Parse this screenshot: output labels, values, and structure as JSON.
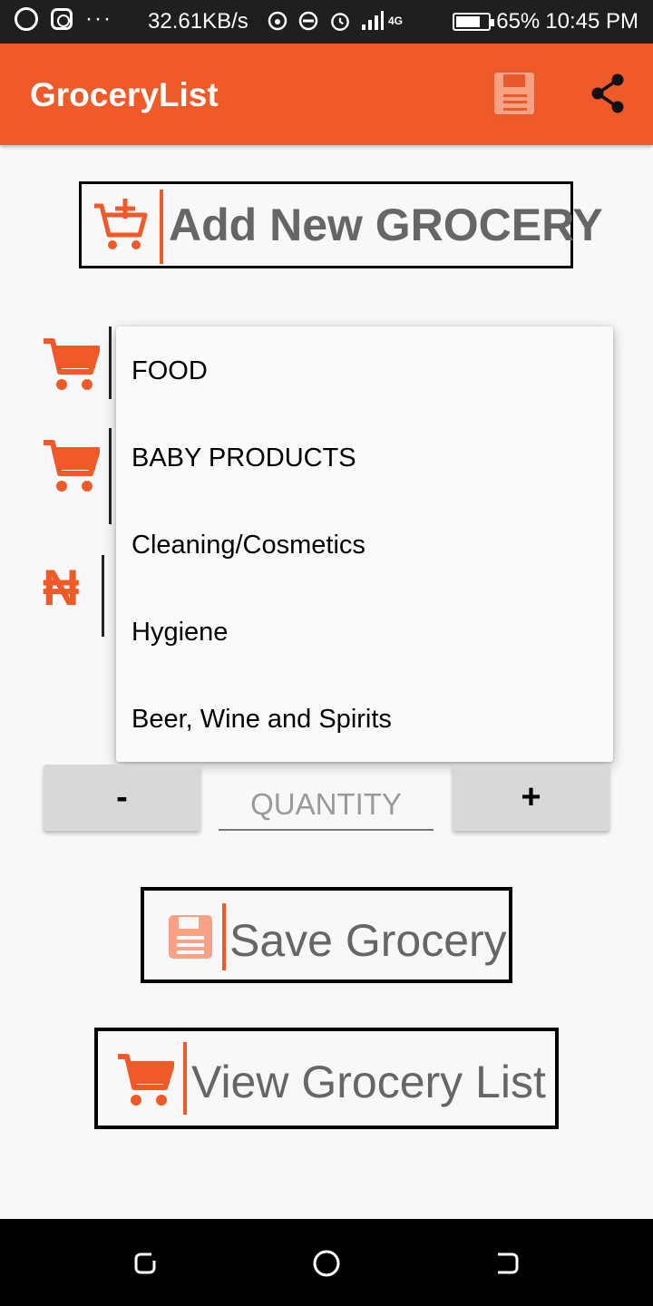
{
  "status_bar": {
    "speed": "32.61KB/s",
    "network": "4G",
    "battery": "65%",
    "time": "10:45 PM"
  },
  "app_bar": {
    "title": "GroceryList",
    "save_icon": "save-icon",
    "share_icon": "share-icon"
  },
  "header": {
    "label": "Add New GROCERY",
    "icon": "cart-plus-icon"
  },
  "form": {
    "category_icon": "cart-icon",
    "subcategory_icon": "cart-icon",
    "price_icon": "naira-icon",
    "currency_symbol": "₦"
  },
  "dropdown": {
    "options": [
      "FOOD",
      "BABY PRODUCTS",
      "Cleaning/Cosmetics",
      "Hygiene",
      "Beer, Wine and Spirits"
    ]
  },
  "quantity": {
    "minus_label": "-",
    "plus_label": "+",
    "placeholder": "QUANTITY"
  },
  "actions": {
    "save_label": "Save Grocery",
    "view_label": "View Grocery List"
  },
  "colors": {
    "accent": "#f05a28",
    "status_bar": "#1f1f1f",
    "background": "#f8f8f8"
  }
}
